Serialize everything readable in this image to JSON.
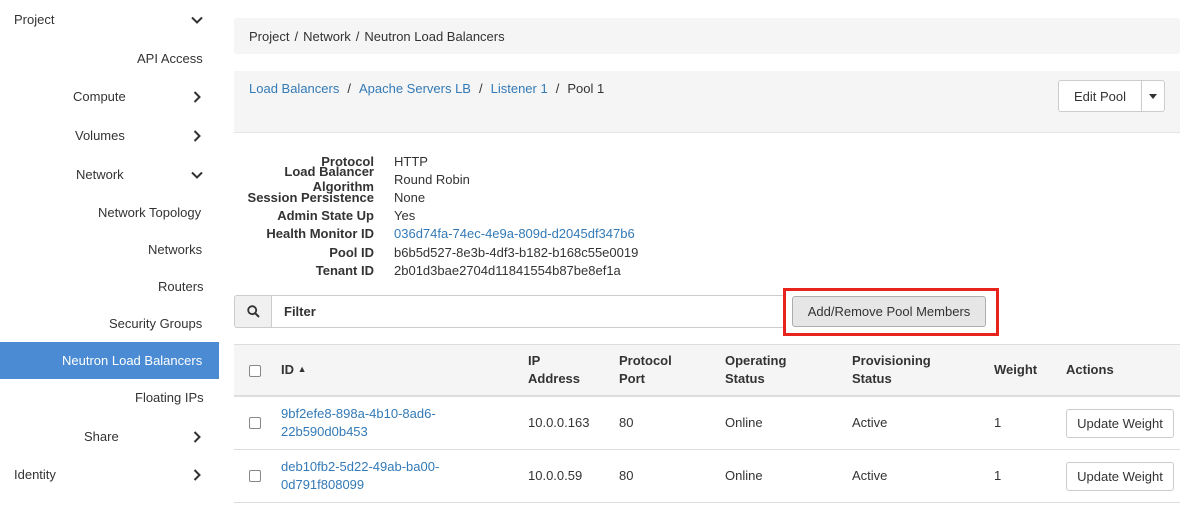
{
  "sidebar": {
    "items": [
      {
        "label": "Project",
        "chevron": "down"
      },
      {
        "label": "API Access"
      },
      {
        "label": "Compute",
        "chevron": "right"
      },
      {
        "label": "Volumes",
        "chevron": "right"
      },
      {
        "label": "Network",
        "chevron": "down"
      },
      {
        "label": "Network Topology"
      },
      {
        "label": "Networks"
      },
      {
        "label": "Routers"
      },
      {
        "label": "Security Groups"
      },
      {
        "label": "Neutron Load Balancers",
        "active": true
      },
      {
        "label": "Floating IPs"
      },
      {
        "label": "Share",
        "chevron": "right"
      },
      {
        "label": "Identity",
        "chevron": "right"
      }
    ]
  },
  "breadcrumb": [
    "Project",
    "Network",
    "Neutron Load Balancers"
  ],
  "page_header": {
    "crumbs": [
      "Load Balancers",
      "Apache Servers LB",
      "Listener 1",
      "Pool 1"
    ],
    "edit_button": "Edit Pool"
  },
  "details": [
    {
      "label": "Protocol",
      "value": "HTTP"
    },
    {
      "label": "Load Balancer Algorithm",
      "value": "Round Robin"
    },
    {
      "label": "Session Persistence",
      "value": "None"
    },
    {
      "label": "Admin State Up",
      "value": "Yes"
    },
    {
      "label": "Health Monitor ID",
      "value": "036d74fa-74ec-4e9a-809d-d2045df347b6",
      "link": true
    },
    {
      "label": "Pool ID",
      "value": "b6b5d527-8e3b-4df3-b182-b168c55e0019"
    },
    {
      "label": "Tenant ID",
      "value": "2b01d3bae2704d11841554b87be8ef1a"
    }
  ],
  "filter": {
    "placeholder": "Filter"
  },
  "add_members_button": "Add/Remove Pool Members",
  "table": {
    "headers": {
      "id": "ID",
      "ip1": "IP",
      "ip2": "Address",
      "proto1": "Protocol",
      "proto2": "Port",
      "op1": "Operating",
      "op2": "Status",
      "prov1": "Provisioning",
      "prov2": "Status",
      "weight": "Weight",
      "actions": "Actions"
    },
    "rows": [
      {
        "id1": "9bf2efe8-898a-4b10-8ad6-",
        "id2": "22b590d0b453",
        "ip": "10.0.0.163",
        "port": "80",
        "op": "Online",
        "prov": "Active",
        "weight": "1",
        "action": "Update Weight"
      },
      {
        "id1": "deb10fb2-5d22-49ab-ba00-",
        "id2": "0d791f808099",
        "ip": "10.0.0.59",
        "port": "80",
        "op": "Online",
        "prov": "Active",
        "weight": "1",
        "action": "Update Weight"
      }
    ]
  },
  "colors": {
    "active_bg": "#4a8bd3",
    "link": "#337ab7",
    "highlight": "#e8231c"
  }
}
